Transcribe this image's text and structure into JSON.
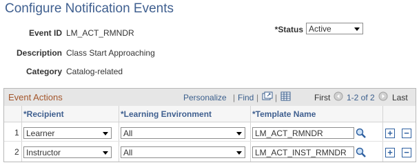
{
  "page": {
    "title": "Configure Notification Events"
  },
  "event": {
    "event_id_label": "Event ID",
    "event_id_value": "LM_ACT_RMNDR",
    "status_label": "*Status",
    "status_value": "Active",
    "description_label": "Description",
    "description_value": "Class Start Approaching",
    "category_label": "Category",
    "category_value": "Catalog-related"
  },
  "grid": {
    "title": "Event Actions",
    "personalize": "Personalize",
    "find": "Find",
    "sep": "|",
    "first": "First",
    "range": "1-2 of 2",
    "last": "Last",
    "columns": {
      "recipient": "*Recipient",
      "environment": "*Learning Environment",
      "template": "*Template Name"
    },
    "rows": [
      {
        "num": "1",
        "recipient": "Learner",
        "environment": "All",
        "template": "LM_ACT_RMNDR"
      },
      {
        "num": "2",
        "recipient": "Instructor",
        "environment": "All",
        "template": "LM_ACT_INST_RMNDR"
      }
    ],
    "add_symbol": "+",
    "remove_symbol": "−"
  },
  "colors": {
    "title": "#3f5f8f",
    "grid_title": "#a3552a",
    "link": "#3a5e8c"
  }
}
